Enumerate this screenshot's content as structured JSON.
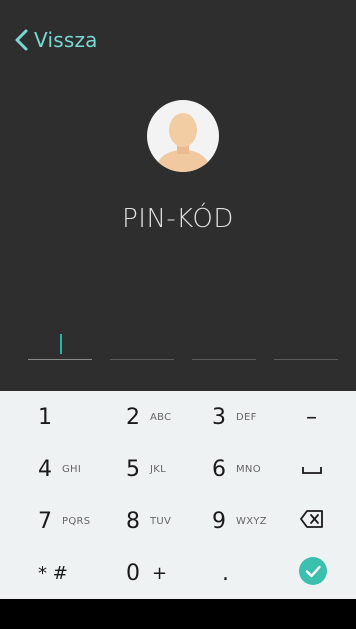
{
  "nav": {
    "back_label": "Vissza"
  },
  "header": {
    "title": "PIN-KÓD"
  },
  "colors": {
    "accent": "#27b3a6",
    "back_text": "#7ad8d2",
    "top_bg": "#2e2e2e",
    "keypad_bg": "#eef2f3"
  },
  "keypad": {
    "rows": [
      [
        {
          "num": "1",
          "letters": ""
        },
        {
          "num": "2",
          "letters": "ABC"
        },
        {
          "num": "3",
          "letters": "DEF"
        },
        {
          "action": "–"
        }
      ],
      [
        {
          "num": "4",
          "letters": "GHI"
        },
        {
          "num": "5",
          "letters": "JKL"
        },
        {
          "num": "6",
          "letters": "MNO"
        },
        {
          "action": "space-icon"
        }
      ],
      [
        {
          "num": "7",
          "letters": "PQRS"
        },
        {
          "num": "8",
          "letters": "TUV"
        },
        {
          "num": "9",
          "letters": "WXYZ"
        },
        {
          "action": "backspace-icon"
        }
      ],
      [
        {
          "num": "* #",
          "letters": ""
        },
        {
          "num": "0",
          "sym": "+"
        },
        {
          "num": "."
        },
        {
          "action": "done-check-icon"
        }
      ]
    ],
    "minus_label": "–",
    "k1": "1",
    "k2": "2",
    "k2l": "ABC",
    "k3": "3",
    "k3l": "DEF",
    "k4": "4",
    "k4l": "GHI",
    "k5": "5",
    "k5l": "JKL",
    "k6": "6",
    "k6l": "MNO",
    "k7": "7",
    "k7l": "PQRS",
    "k8": "8",
    "k8l": "TUV",
    "k9": "9",
    "k9l": "WXYZ",
    "kstar": "* #",
    "k0": "0",
    "k0s": "+",
    "kdot": "."
  }
}
